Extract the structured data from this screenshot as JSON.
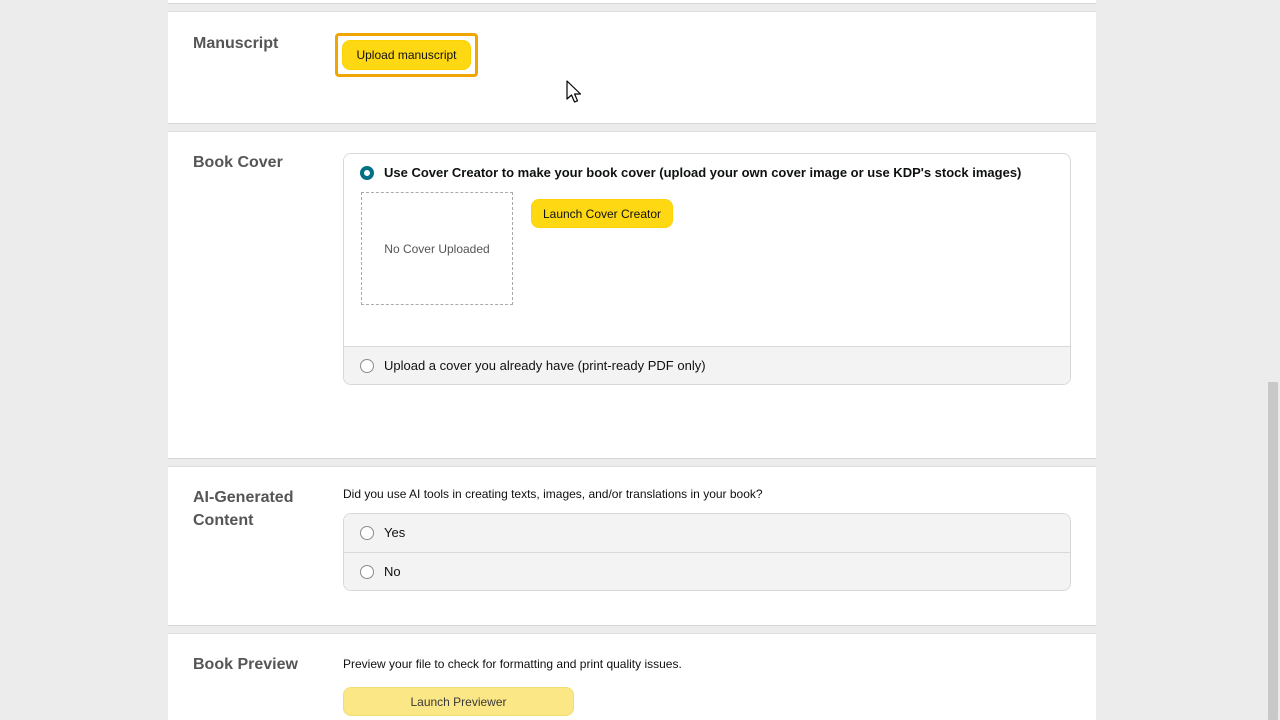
{
  "manuscript": {
    "title": "Manuscript",
    "upload_button": "Upload manuscript"
  },
  "book_cover": {
    "title": "Book Cover",
    "option_cover_creator": "Use Cover Creator to make your book cover (upload your own cover image or use KDP's stock images)",
    "placeholder_text": "No Cover Uploaded",
    "launch_button": "Launch Cover Creator",
    "option_upload": "Upload a cover you already have (print-ready PDF only)",
    "selected_option": "cover_creator"
  },
  "ai_content": {
    "title_line1": "AI-Generated",
    "title_line2": "Content",
    "question": "Did you use AI tools in creating texts, images, and/or translations in your book?",
    "options": [
      "Yes",
      "No"
    ]
  },
  "book_preview": {
    "title": "Book Preview",
    "description": "Preview your file to check for formatting and print quality issues.",
    "launch_button": "Launch Previewer"
  },
  "colors": {
    "accent_yellow": "#ffd814",
    "focus_orange": "#f0a500",
    "radio_selected": "#007185",
    "disabled_yellow": "#fbe785"
  },
  "icons": {
    "cursor": "mouse-pointer-icon"
  }
}
